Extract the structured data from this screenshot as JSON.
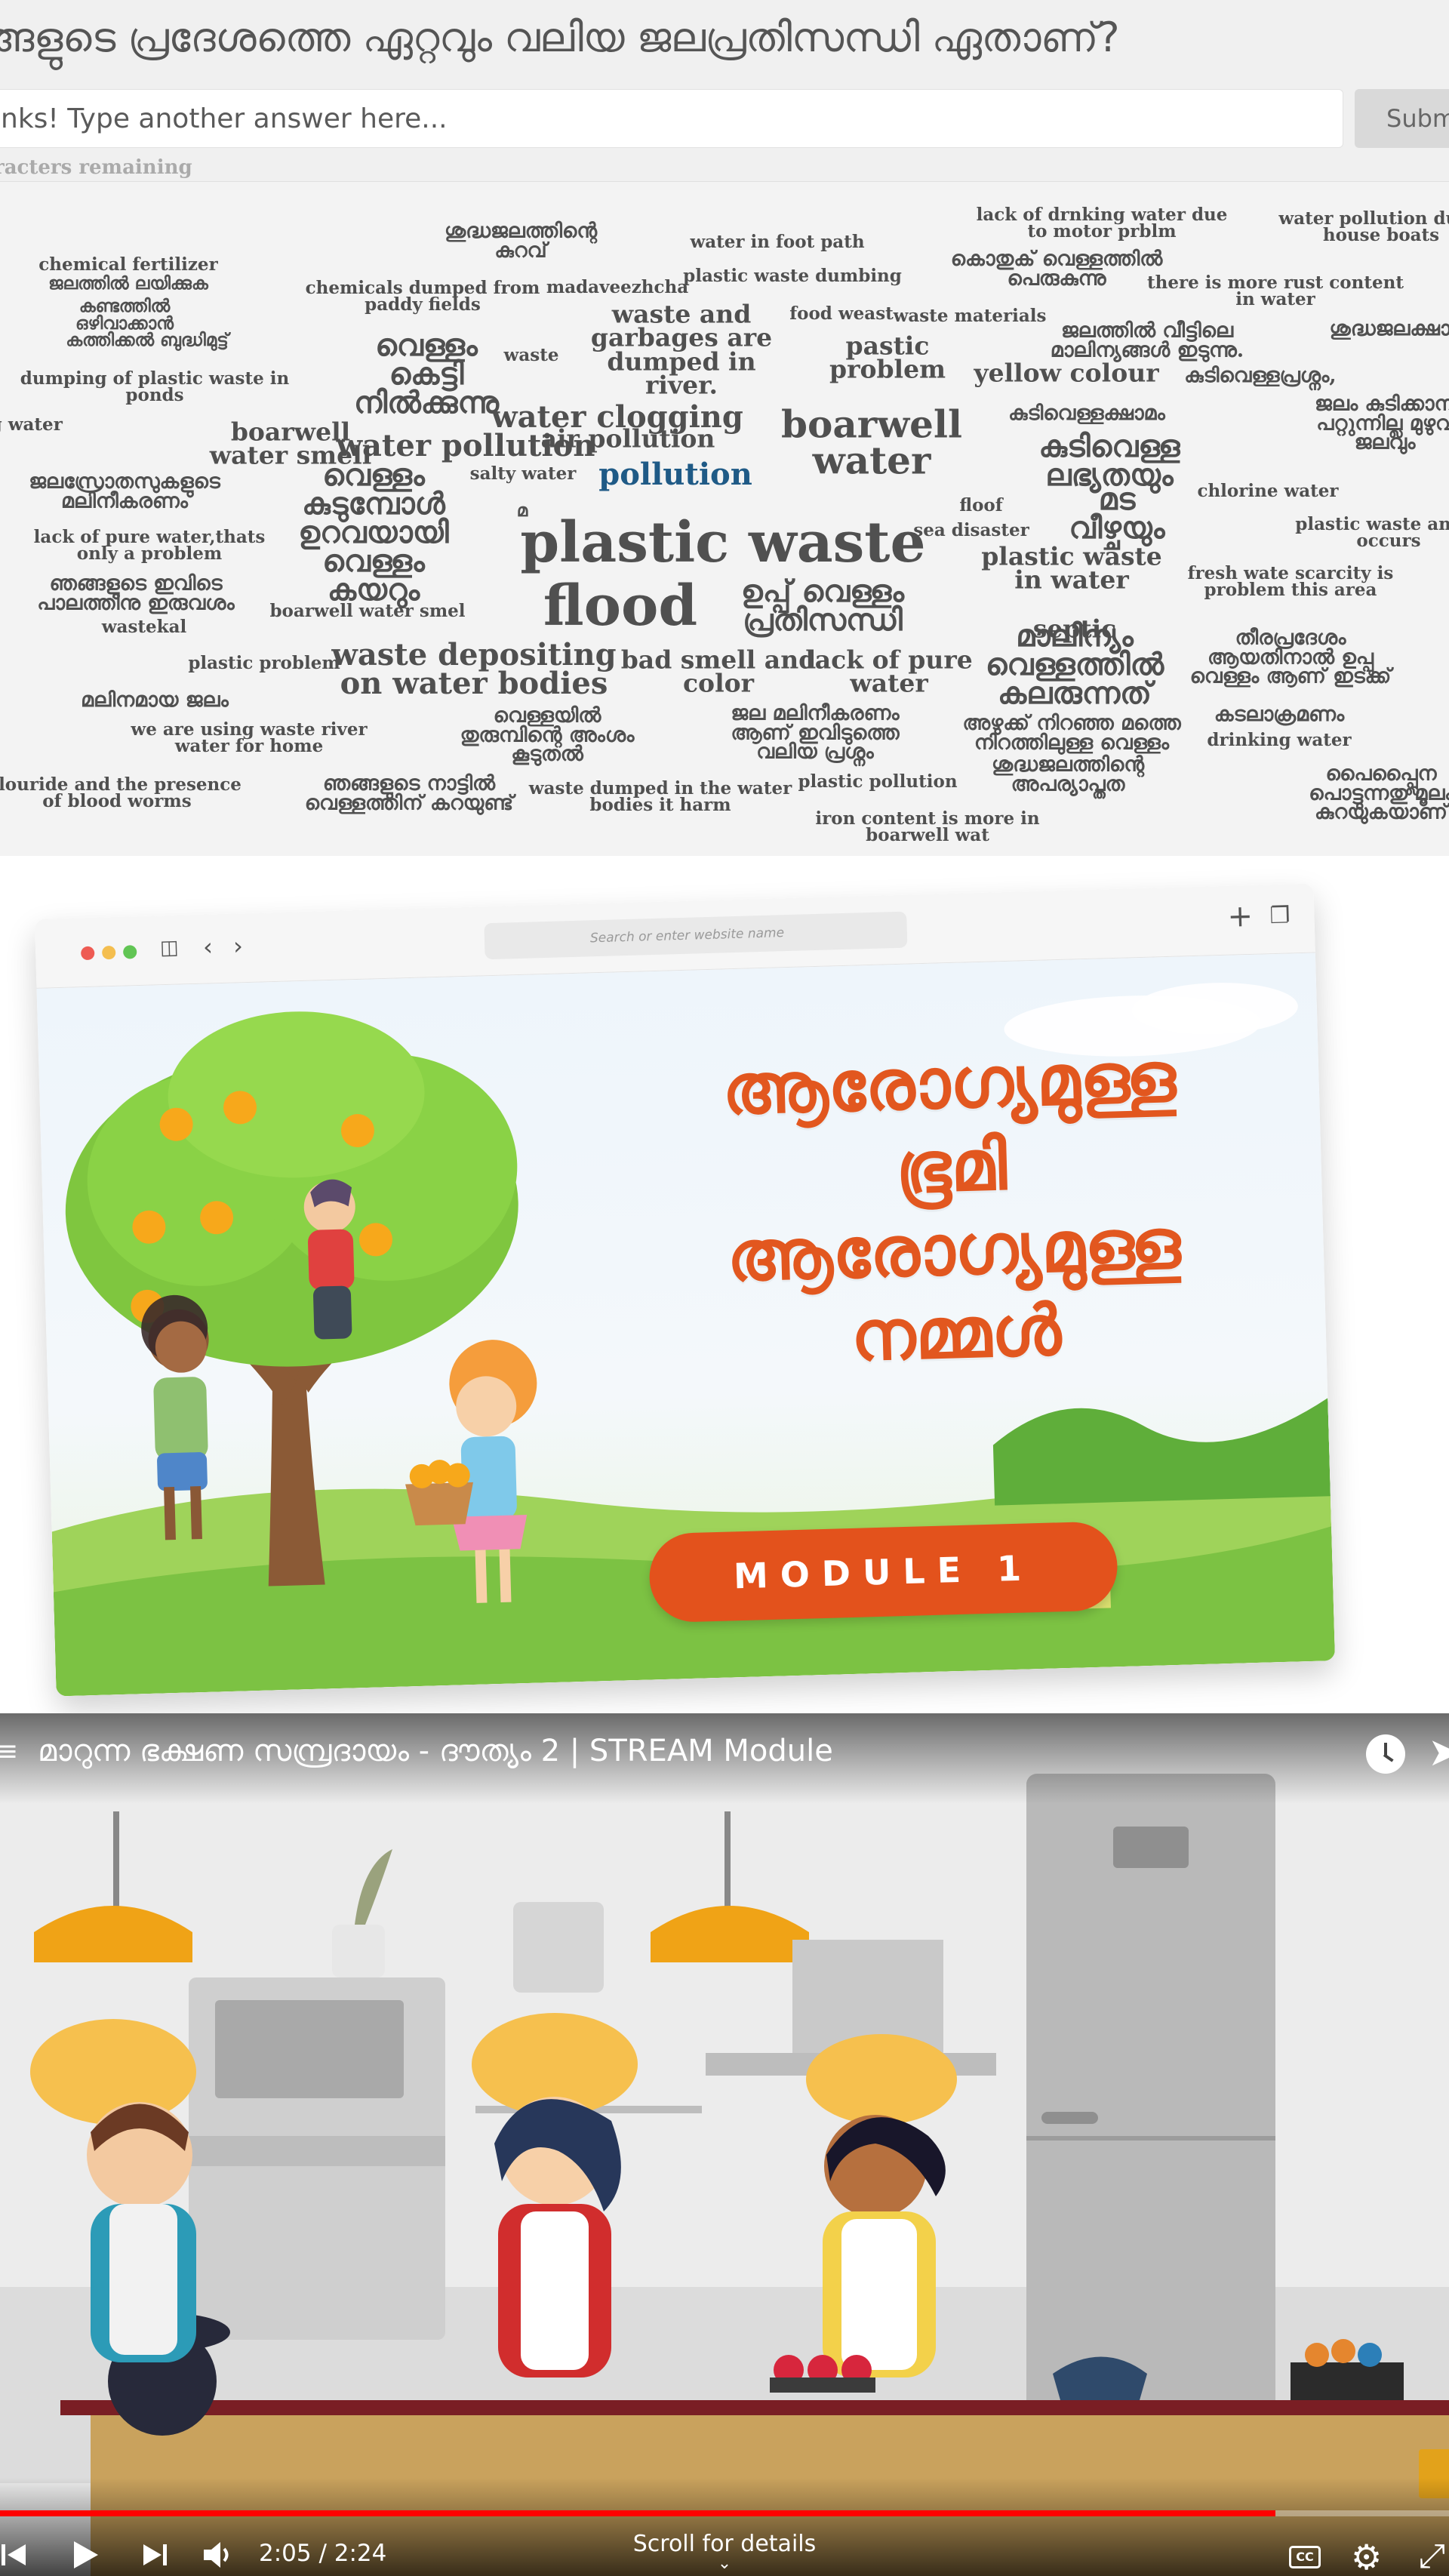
{
  "wordcloud_page": {
    "question": "ങ്ങളുടെ പ്രദേശത്തെ ഏറ്റവും വലിയ ജലപ്രതിസന്ധി ഏതാണ്?",
    "answer_placeholder": "nks! Type another answer here...",
    "submit_label": "Subm",
    "chars_remaining": "racters remaining",
    "words": [
      {
        "text": "ശുദ്ധജലത്തിന്റെ\nകുറവ്",
        "size": "m"
      },
      {
        "text": "water in foot path",
        "size": "s"
      },
      {
        "text": "lack of drnking water due\nto motor prblm",
        "size": "s"
      },
      {
        "text": "water pollution due t\nhouse boats",
        "size": "s"
      },
      {
        "text": "chemical fertilizer",
        "size": "s"
      },
      {
        "text": "ജലത്തിൽ ലയിക്കുക",
        "size": "s"
      },
      {
        "text": "chemicals dumped from\npaddy fields",
        "size": "s"
      },
      {
        "text": "madaveezhcha",
        "size": "s"
      },
      {
        "text": "plastic waste dumbing",
        "size": "s"
      },
      {
        "text": "കൊതുക് വെള്ളത്തിൽ\nപെരുകുന്നു",
        "size": "m"
      },
      {
        "text": "there is more rust content\nin water",
        "size": "s"
      },
      {
        "text": "കണ്ടത്തിൽ",
        "size": "s"
      },
      {
        "text": "ഒഴിവാക്കാൻ",
        "size": "s"
      },
      {
        "text": "കത്തിക്കൽ ബുദ്ധിമുട്ട്",
        "size": "s"
      },
      {
        "text": "waste and\ngarbages are\ndumped in\nriver.",
        "size": "ml"
      },
      {
        "text": "food weast",
        "size": "s"
      },
      {
        "text": "waste materials",
        "size": "s"
      },
      {
        "text": "ജലത്തിൽ വീട്ടിലെ\nമാലിന്യങ്ങൾ ഇടുന്നു.",
        "size": "m"
      },
      {
        "text": "ശുദ്ധജലക്ഷാമ",
        "size": "m"
      },
      {
        "text": "വെള്ളം\nകെട്ടി\nനിൽക്കുന്നു",
        "size": "l"
      },
      {
        "text": "waste",
        "size": "s"
      },
      {
        "text": "pastic\nproblem",
        "size": "ml"
      },
      {
        "text": "yellow colour",
        "size": "ml"
      },
      {
        "text": "കുടിവെള്ളപ്രശ്നം,",
        "size": "m"
      },
      {
        "text": "dumping of plastic waste in\nponds",
        "size": "s"
      },
      {
        "text": "water clogging",
        "size": "l"
      },
      {
        "text": "air pollution",
        "size": "ml"
      },
      {
        "text": "boarwell\nwater",
        "size": "xl"
      },
      {
        "text": "കുടിവെള്ളക്ഷാമം",
        "size": "m"
      },
      {
        "text": "ജലം കുടിക്കാന്\nപറ്റുന്നില്ല മുഴുവ\nജലവും",
        "size": "m"
      },
      {
        "text": "ing water",
        "size": "s"
      },
      {
        "text": "boarwell\nwater smell",
        "size": "ml"
      },
      {
        "text": "water pollution",
        "size": "l"
      },
      {
        "text": "salty water",
        "size": "s"
      },
      {
        "text": "pollution",
        "size": "l",
        "accent": true
      },
      {
        "text": "കുടിവെള്ള\nലഭ്യതയും",
        "size": "l"
      },
      {
        "text": "ജലസ്രോതസുകളുടെ\nമലിനീകരണം",
        "size": "m"
      },
      {
        "text": "വെള്ളം\nകുടുമ്പോൾ\nഉറവയായി\nവെള്ളം\nകയറും",
        "size": "l"
      },
      {
        "text": "മ",
        "size": "s"
      },
      {
        "text": "plastic waste",
        "size": "xxl"
      },
      {
        "text": "floof",
        "size": "s"
      },
      {
        "text": "sea disaster",
        "size": "s"
      },
      {
        "text": "മട\nവീഴ്ചയും",
        "size": "l"
      },
      {
        "text": "chlorine water",
        "size": "s"
      },
      {
        "text": "plastic waste and fl\noccurs",
        "size": "s"
      },
      {
        "text": "lack of pure water,thats\nonly a problem",
        "size": "s"
      },
      {
        "text": "plastic waste\nin water",
        "size": "ml"
      },
      {
        "text": "fresh wate scarcity is\nproblem this area",
        "size": "s"
      },
      {
        "text": "ഞങ്ങളുടെ ഇവിടെ\nപാലത്തിനു ഇരുവശം",
        "size": "m"
      },
      {
        "text": "wastekal",
        "size": "s"
      },
      {
        "text": "flood",
        "size": "xxl"
      },
      {
        "text": "ഉപ്പ് വെള്ളം\nപ്രതിസന്ധി",
        "size": "l"
      },
      {
        "text": "boarwell water smel",
        "size": "s"
      },
      {
        "text": "septic",
        "size": "ml"
      },
      {
        "text": "മാലിന്യം\nവെള്ളത്തിൽ\nകലരുന്നത്",
        "size": "l"
      },
      {
        "text": "തീരപ്രദേശം\nആയതിനാൽ ഉപ്പു\nവെള്ളം ആണ് ഇടക്ക്",
        "size": "m"
      },
      {
        "text": "plastic problem",
        "size": "s"
      },
      {
        "text": "waste depositing\non water bodies",
        "size": "l"
      },
      {
        "text": "bad smell and\ncolor",
        "size": "ml"
      },
      {
        "text": "lack of pure\nwater",
        "size": "ml"
      },
      {
        "text": "മലിനമായ ജലം",
        "size": "m"
      },
      {
        "text": "ജല മലിനീകരണം\nആണ് ഇവിടുത്തെ\nവലിയ പ്രശ്നം",
        "size": "m"
      },
      {
        "text": "അഴുക്ക് നിറഞ്ഞ മത്തെ\nനിറത്തിലുള്ള വെള്ളം",
        "size": "m"
      },
      {
        "text": "കടലാക്രമണം",
        "size": "m"
      },
      {
        "text": "we are using waste river\nwater for home",
        "size": "s"
      },
      {
        "text": "വെള്ളയിൽ\nതുരുമ്പിന്റെ അംശം\nകൂടുതൽ",
        "size": "m"
      },
      {
        "text": "drinking water",
        "size": "s"
      },
      {
        "text": "ശുദ്ധജലത്തിന്റെ\nഅപര്യാപ്തത",
        "size": "m"
      },
      {
        "text": "പൈപ്പ്ലൈന\nപൊട്ടുന്നതു മൂലം\nകുറയുകയാണ്",
        "size": "m"
      },
      {
        "text": "flouride and the presence\nof blood worms",
        "size": "s"
      },
      {
        "text": "ഞങ്ങളുടെ നാട്ടിൽ\nവെള്ളത്തിന് കറയുണ്ട്",
        "size": "m"
      },
      {
        "text": "waste dumped in the water\nbodies it harm",
        "size": "s"
      },
      {
        "text": "plastic pollution",
        "size": "s"
      },
      {
        "text": "iron content is more in\nboarwell wat",
        "size": "s"
      }
    ]
  },
  "module_banner": {
    "url_placeholder": "Search or enter website name",
    "new_tab_icon": "plus-icon",
    "tabs_icon": "tabs-icon",
    "title": "ആരോഗ്യമുള്ള\nഭൂമി\nആരോഗ്യമുള്ള\nനമ്മൾ",
    "module_label": "MODULE 1",
    "colors": {
      "title": "#e2571f",
      "button": "#e3521c"
    }
  },
  "video_player": {
    "title": "മാറുന്ന ഭക്ഷണ സമ്പ്രദായം - ദൗത്യം 2 | STREAM Module",
    "time": "2:05 / 2:24",
    "progress": 0.88,
    "scroll_hint": "Scroll for details",
    "cc_label": "CC",
    "colors": {
      "progress": "#ff0000"
    }
  }
}
